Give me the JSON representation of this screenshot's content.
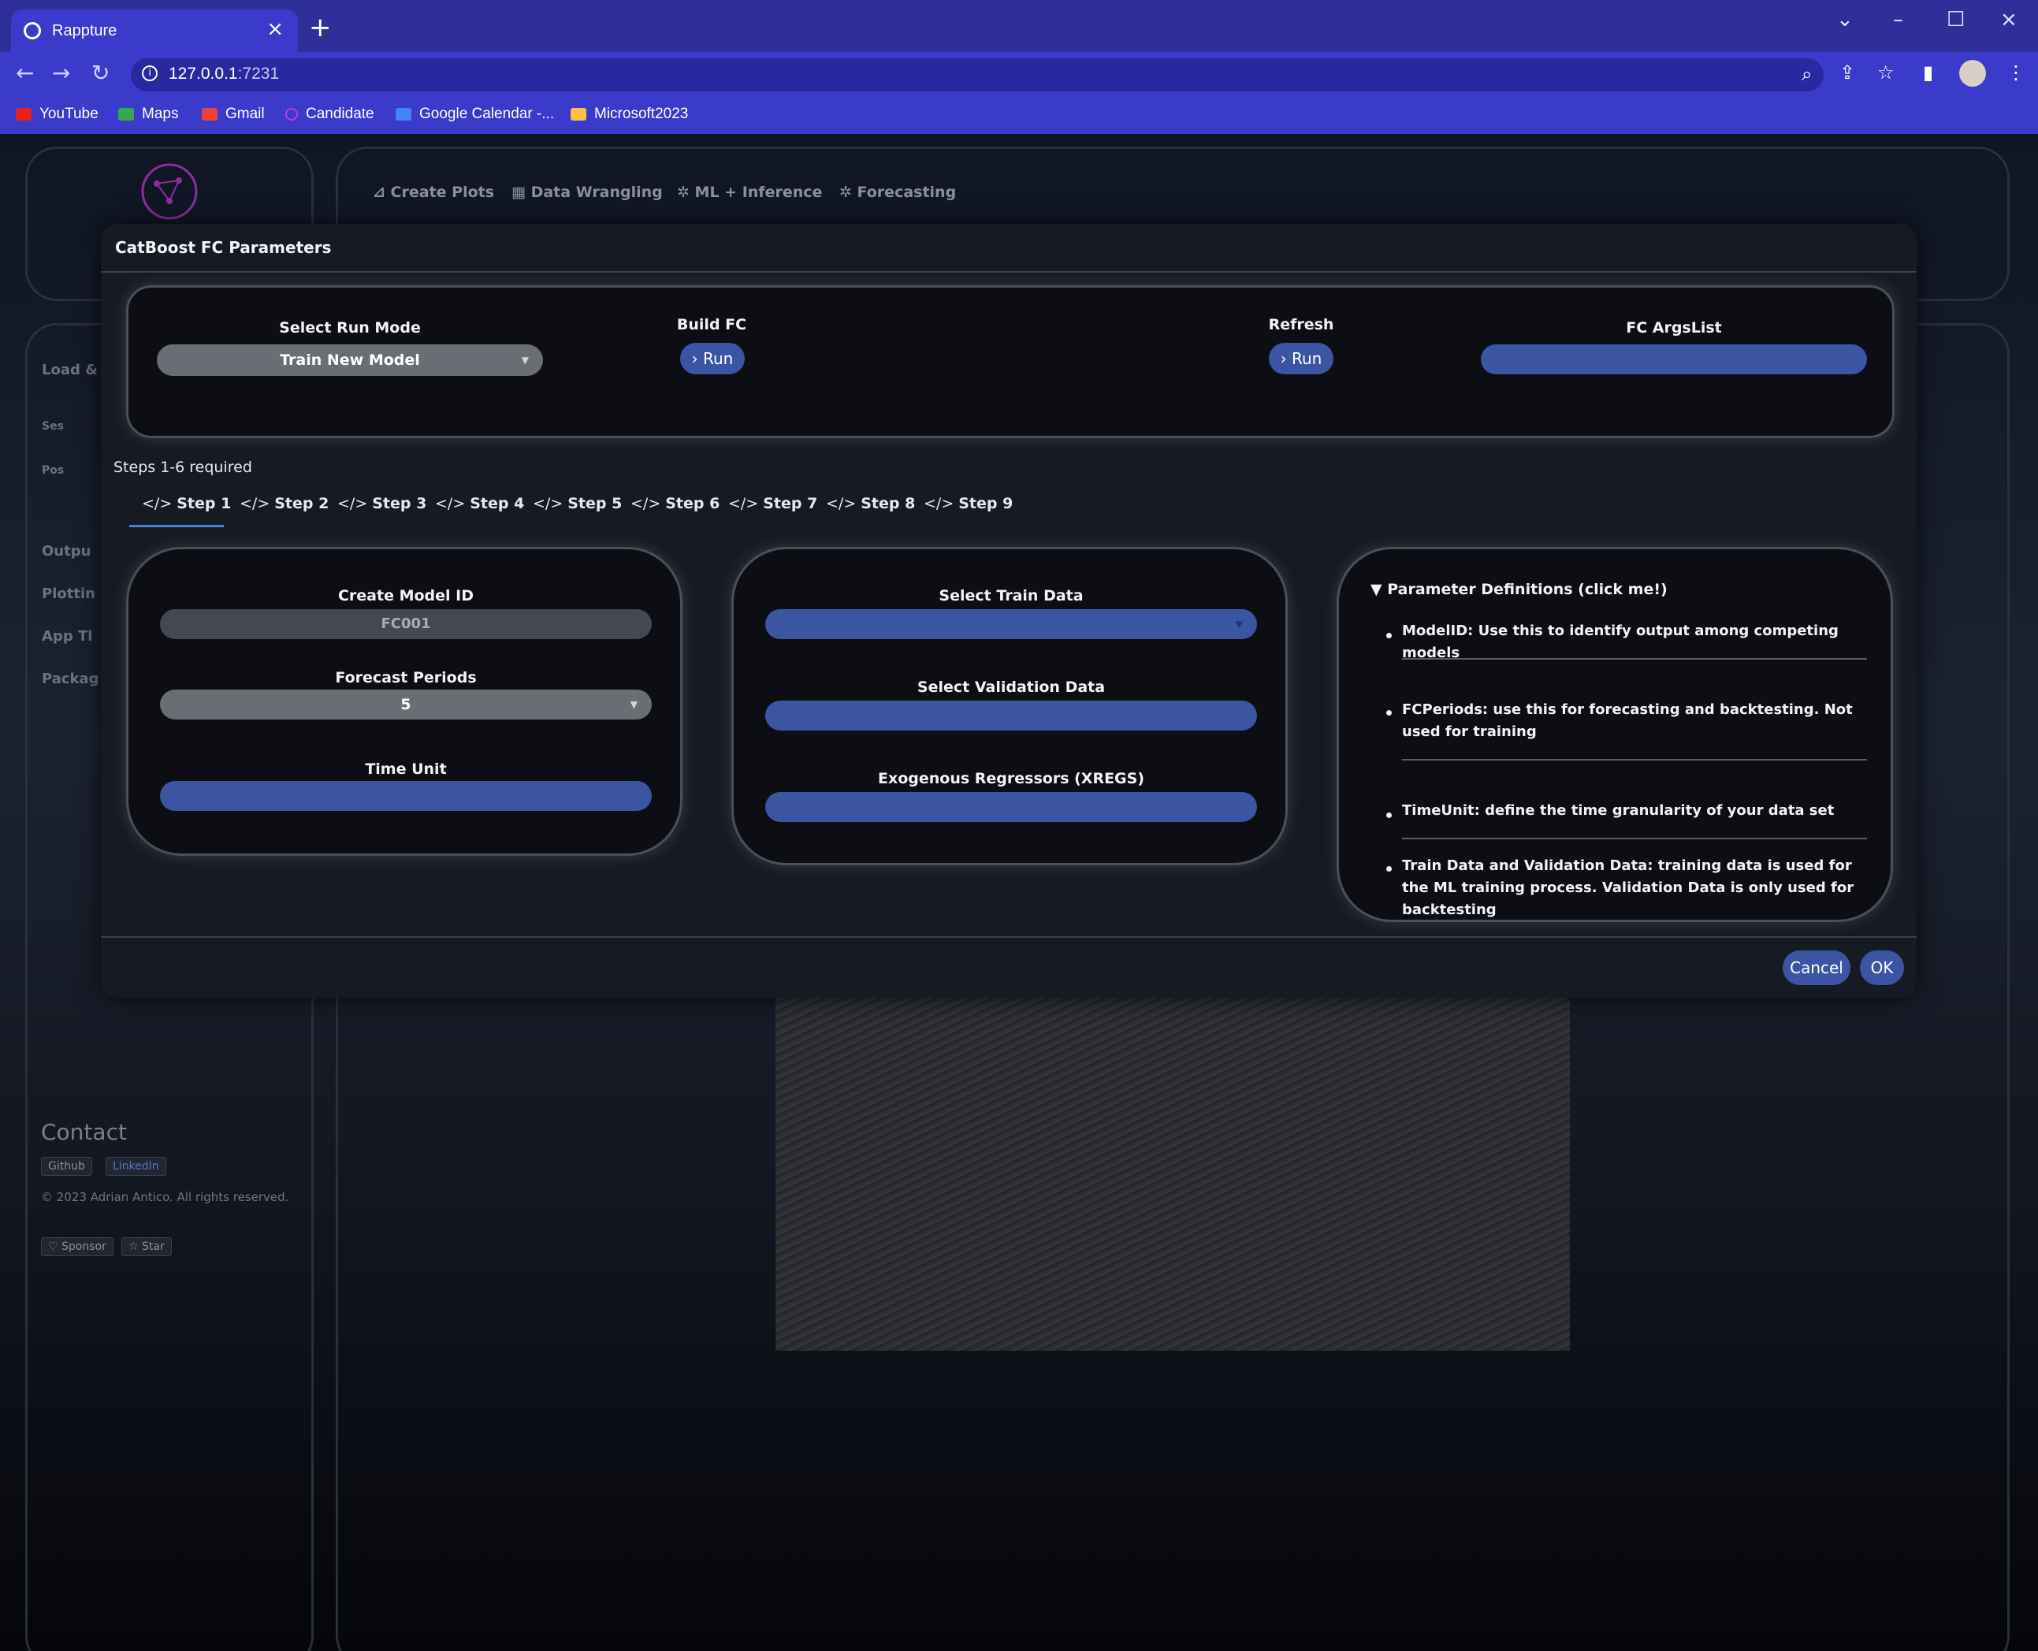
{
  "browser": {
    "tab_title": "Rappture",
    "url_host": "127.0.0.1",
    "url_port": ":7231",
    "bookmarks": [
      "YouTube",
      "Maps",
      "Gmail",
      "Candidate",
      "Google Calendar -...",
      "Microsoft2023"
    ]
  },
  "background": {
    "nav_tabs": [
      "Create Plots",
      "Data Wrangling",
      "ML + Inference",
      "Forecasting"
    ],
    "sidebar_items": [
      "Load &",
      "Ses",
      "Pos",
      "Outpu",
      "Plottin",
      "App Tl",
      "Packag"
    ],
    "contact_title": "Contact",
    "contact_links": [
      "Github",
      "LinkedIn"
    ],
    "copyright": "© 2023 Adrian Antico. All rights reserved.",
    "sponsor_label": "Sponsor",
    "star_label": "Star"
  },
  "modal": {
    "title": "CatBoost FC Parameters",
    "run_mode_label": "Select Run Mode",
    "run_mode_value": "Train New Model",
    "build_fc_label": "Build FC",
    "run_label": "Run",
    "refresh_label": "Refresh",
    "fc_argslist_label": "FC ArgsList",
    "steps_required": "Steps 1-6 required",
    "steps": [
      "Step 1",
      "Step 2",
      "Step 3",
      "Step 4",
      "Step 5",
      "Step 6",
      "Step 7",
      "Step 8",
      "Step 9"
    ],
    "active_step": "Step 1",
    "model_id_label": "Create Model ID",
    "model_id_value": "FC001",
    "forecast_periods_label": "Forecast Periods",
    "forecast_periods_value": "5",
    "time_unit_label": "Time Unit",
    "train_data_label": "Select Train Data",
    "validation_data_label": "Select Validation Data",
    "xregs_label": "Exogenous Regressors (XREGS)",
    "definitions_title": "Parameter Definitions (click me!)",
    "definitions": [
      "ModelID: Use this to identify output among competing models",
      "FCPeriods: use this for forecasting and backtesting. Not used for training",
      "TimeUnit: define the time granularity of your data set",
      "Train Data and Validation Data: training data is used for the ML training process. Validation Data is only used for backtesting"
    ],
    "cancel_label": "Cancel",
    "ok_label": "OK"
  },
  "colors": {
    "browser_tab": "#3a3acb",
    "modal_bg": "#161b23",
    "accent_blue": "#3b55a3"
  }
}
